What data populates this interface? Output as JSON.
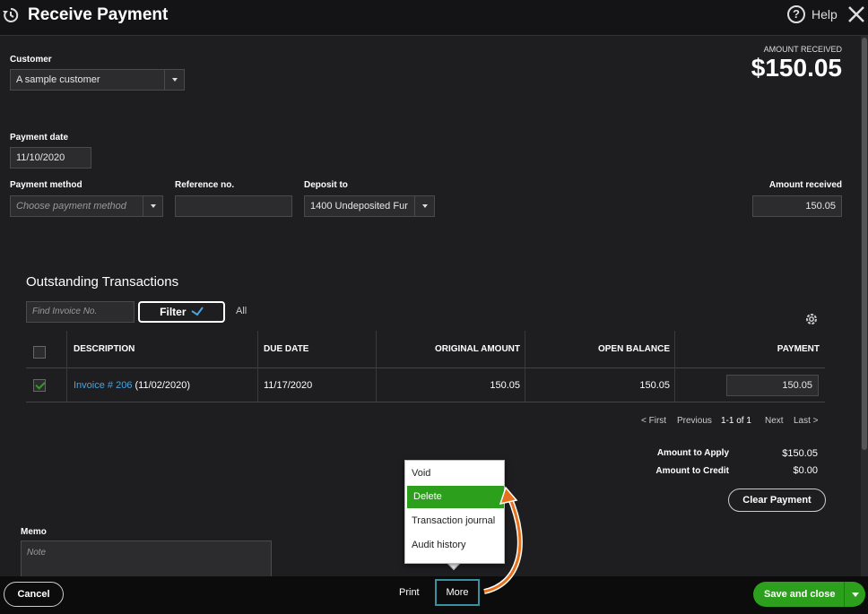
{
  "header": {
    "title": "Receive Payment",
    "help_label": "Help",
    "help_glyph": "?"
  },
  "amount_summary": {
    "caption": "AMOUNT RECEIVED",
    "value": "$150.05"
  },
  "form": {
    "customer_label": "Customer",
    "customer_value": "A sample customer",
    "payment_date_label": "Payment date",
    "payment_date_value": "11/10/2020",
    "payment_method_label": "Payment method",
    "payment_method_placeholder": "Choose payment method",
    "reference_label": "Reference no.",
    "reference_value": "",
    "deposit_to_label": "Deposit to",
    "deposit_to_value": "1400 Undeposited Fur",
    "amount_received_label": "Amount received",
    "amount_received_value": "150.05"
  },
  "outstanding": {
    "title": "Outstanding Transactions",
    "find_placeholder": "Find Invoice No.",
    "filter_label": "Filter",
    "all_label": "All",
    "columns": [
      "DESCRIPTION",
      "DUE DATE",
      "ORIGINAL AMOUNT",
      "OPEN BALANCE",
      "PAYMENT"
    ],
    "rows": [
      {
        "invoice_link": "Invoice # 206",
        "invoice_date": "(11/02/2020)",
        "due_date": "11/17/2020",
        "original_amount": "150.05",
        "open_balance": "150.05",
        "payment": "150.05",
        "checked": true
      }
    ],
    "pager": {
      "first": "< First",
      "previous": "Previous",
      "range": "1-1 of 1",
      "next": "Next",
      "last": "Last >"
    }
  },
  "totals": {
    "apply_label": "Amount to Apply",
    "apply_value": "$150.05",
    "credit_label": "Amount to Credit",
    "credit_value": "$0.00",
    "clear_label": "Clear Payment"
  },
  "memo": {
    "label": "Memo",
    "placeholder": "Note"
  },
  "more_menu": {
    "items": [
      "Void",
      "Delete",
      "Transaction journal",
      "Audit history"
    ],
    "active_item": "Delete"
  },
  "footer": {
    "cancel_label": "Cancel",
    "print_label": "Print",
    "more_label": "More",
    "save_label": "Save and close"
  },
  "colors": {
    "accent_green": "#2ca01c",
    "link_blue": "#4aa3df",
    "highlight_teal": "#3a8fa0",
    "arrow_orange": "#e8701a"
  }
}
